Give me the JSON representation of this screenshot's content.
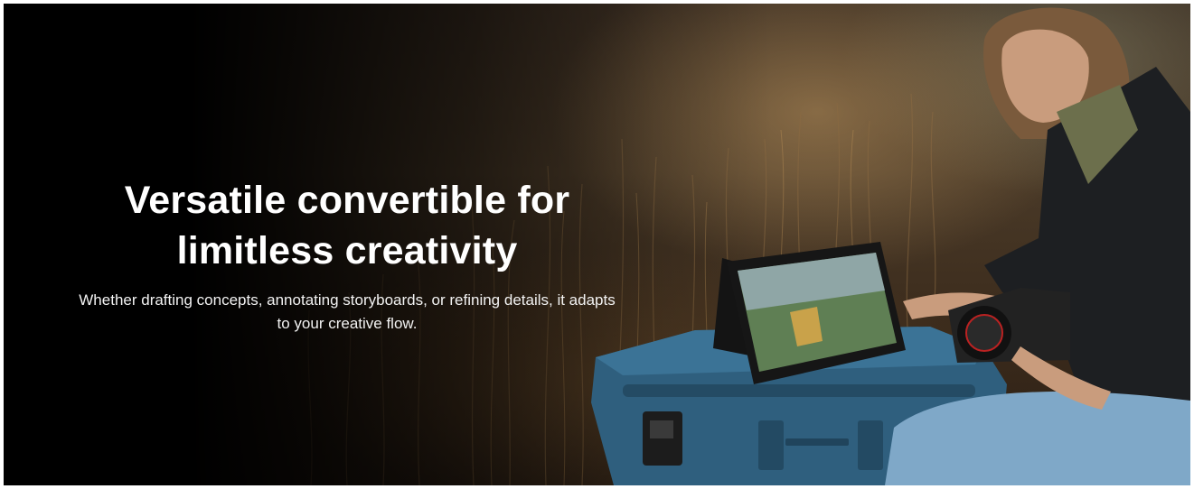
{
  "hero": {
    "headline_line1": "Versatile convertible for",
    "headline_line2": "limitless creativity",
    "subcopy_line1": "Whether drafting concepts, annotating storyboards, or refining details, it adapts",
    "subcopy_line2": "to your creative flow."
  },
  "colors": {
    "background": "#000000",
    "text": "#ffffff",
    "case_blue": "#2f5f7e",
    "jeans_blue": "#7fa8c8",
    "jacket": "#1d1f22"
  }
}
